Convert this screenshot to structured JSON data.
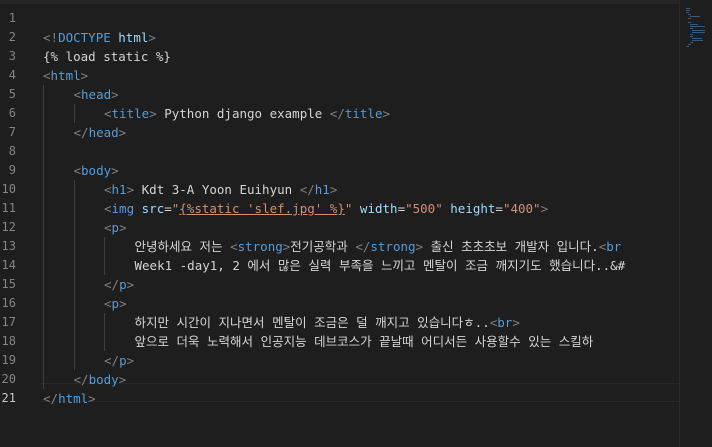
{
  "editor": {
    "active_line": "21",
    "lines": [
      {
        "num": "1",
        "indent": 0,
        "tokens": []
      },
      {
        "num": "2",
        "indent": 0,
        "tokens": [
          {
            "k": "bracket",
            "v": "<!"
          },
          {
            "k": "tag",
            "v": "DOCTYPE"
          },
          {
            "k": "text",
            "v": " "
          },
          {
            "k": "attr",
            "v": "html"
          },
          {
            "k": "bracket",
            "v": ">"
          }
        ]
      },
      {
        "num": "3",
        "indent": 0,
        "tokens": [
          {
            "k": "tpl",
            "v": "{% load static %}"
          }
        ]
      },
      {
        "num": "4",
        "indent": 0,
        "tokens": [
          {
            "k": "bracket",
            "v": "<"
          },
          {
            "k": "tag",
            "v": "html"
          },
          {
            "k": "bracket",
            "v": ">"
          }
        ]
      },
      {
        "num": "5",
        "indent": 1,
        "tokens": [
          {
            "k": "bracket",
            "v": "<"
          },
          {
            "k": "tag",
            "v": "head"
          },
          {
            "k": "bracket",
            "v": ">"
          }
        ]
      },
      {
        "num": "6",
        "indent": 2,
        "tokens": [
          {
            "k": "bracket",
            "v": "<"
          },
          {
            "k": "tag",
            "v": "title"
          },
          {
            "k": "bracket",
            "v": ">"
          },
          {
            "k": "text",
            "v": " Python django example "
          },
          {
            "k": "bracket",
            "v": "</"
          },
          {
            "k": "tag",
            "v": "title"
          },
          {
            "k": "bracket",
            "v": ">"
          }
        ]
      },
      {
        "num": "7",
        "indent": 1,
        "tokens": [
          {
            "k": "bracket",
            "v": "</"
          },
          {
            "k": "tag",
            "v": "head"
          },
          {
            "k": "bracket",
            "v": ">"
          }
        ]
      },
      {
        "num": "8",
        "indent": 1,
        "tokens": []
      },
      {
        "num": "9",
        "indent": 1,
        "tokens": [
          {
            "k": "bracket",
            "v": "<"
          },
          {
            "k": "tag",
            "v": "body"
          },
          {
            "k": "bracket",
            "v": ">"
          }
        ]
      },
      {
        "num": "10",
        "indent": 2,
        "tokens": [
          {
            "k": "bracket",
            "v": "<"
          },
          {
            "k": "tag",
            "v": "h1"
          },
          {
            "k": "bracket",
            "v": ">"
          },
          {
            "k": "text",
            "v": " Kdt 3-A Yoon Euihyun "
          },
          {
            "k": "bracket",
            "v": "</"
          },
          {
            "k": "tag",
            "v": "h1"
          },
          {
            "k": "bracket",
            "v": ">"
          }
        ]
      },
      {
        "num": "11",
        "indent": 2,
        "tokens": [
          {
            "k": "bracket",
            "v": "<"
          },
          {
            "k": "tag",
            "v": "img"
          },
          {
            "k": "text",
            "v": " "
          },
          {
            "k": "attr",
            "v": "src"
          },
          {
            "k": "text",
            "v": "="
          },
          {
            "k": "str",
            "v": "\""
          },
          {
            "k": "str-und",
            "v": "{%static 'slef.jpg' %}"
          },
          {
            "k": "str",
            "v": "\""
          },
          {
            "k": "text",
            "v": " "
          },
          {
            "k": "attr",
            "v": "width"
          },
          {
            "k": "text",
            "v": "="
          },
          {
            "k": "str",
            "v": "\"500\""
          },
          {
            "k": "text",
            "v": " "
          },
          {
            "k": "attr",
            "v": "height"
          },
          {
            "k": "text",
            "v": "="
          },
          {
            "k": "str",
            "v": "\"400\""
          },
          {
            "k": "bracket",
            "v": ">"
          }
        ]
      },
      {
        "num": "12",
        "indent": 2,
        "tokens": [
          {
            "k": "bracket",
            "v": "<"
          },
          {
            "k": "tag",
            "v": "p"
          },
          {
            "k": "bracket",
            "v": ">"
          }
        ]
      },
      {
        "num": "13",
        "indent": 3,
        "tokens": [
          {
            "k": "text",
            "v": "안녕하세요 저는 "
          },
          {
            "k": "bracket",
            "v": "<"
          },
          {
            "k": "tag",
            "v": "strong"
          },
          {
            "k": "bracket",
            "v": ">"
          },
          {
            "k": "text",
            "v": "전기공학과 "
          },
          {
            "k": "bracket",
            "v": "</"
          },
          {
            "k": "tag",
            "v": "strong"
          },
          {
            "k": "bracket",
            "v": ">"
          },
          {
            "k": "text",
            "v": " 출신 초초초보 개발자 입니다."
          },
          {
            "k": "bracket",
            "v": "<"
          },
          {
            "k": "tag",
            "v": "br"
          }
        ]
      },
      {
        "num": "14",
        "indent": 3,
        "tokens": [
          {
            "k": "text",
            "v": "Week1 -day1, 2 에서 많은 실력 부족을 느끼고 멘탈이 조금 깨지기도 했습니다..&#"
          }
        ]
      },
      {
        "num": "15",
        "indent": 2,
        "tokens": [
          {
            "k": "bracket",
            "v": "</"
          },
          {
            "k": "tag",
            "v": "p"
          },
          {
            "k": "bracket",
            "v": ">"
          }
        ]
      },
      {
        "num": "16",
        "indent": 2,
        "tokens": [
          {
            "k": "bracket",
            "v": "<"
          },
          {
            "k": "tag",
            "v": "p"
          },
          {
            "k": "bracket",
            "v": ">"
          }
        ]
      },
      {
        "num": "17",
        "indent": 3,
        "tokens": [
          {
            "k": "text",
            "v": "하지만 시간이 지나면서 멘탈이 조금은 덜 깨지고 있습니다ㅎ.."
          },
          {
            "k": "bracket",
            "v": "<"
          },
          {
            "k": "tag",
            "v": "br"
          },
          {
            "k": "bracket",
            "v": ">"
          }
        ]
      },
      {
        "num": "18",
        "indent": 3,
        "tokens": [
          {
            "k": "text",
            "v": "앞으로 더욱 노력해서 인공지능 데브코스가 끝날때 어디서든 사용할수 있는 스킬하"
          }
        ]
      },
      {
        "num": "19",
        "indent": 2,
        "tokens": [
          {
            "k": "bracket",
            "v": "</"
          },
          {
            "k": "tag",
            "v": "p"
          },
          {
            "k": "bracket",
            "v": ">"
          }
        ]
      },
      {
        "num": "20",
        "indent": 1,
        "tokens": [
          {
            "k": "bracket",
            "v": "</"
          },
          {
            "k": "tag",
            "v": "body"
          },
          {
            "k": "bracket",
            "v": ">"
          }
        ]
      },
      {
        "num": "21",
        "indent": 0,
        "tokens": [
          {
            "k": "bracket",
            "v": "</"
          },
          {
            "k": "tag",
            "v": "html"
          },
          {
            "k": "bracket",
            "v": ">"
          }
        ]
      }
    ]
  },
  "colors": {
    "background": "#1e1e1e",
    "tag": "#569cd6",
    "attribute": "#9cdcfe",
    "string": "#ce9178",
    "bracket": "#808080",
    "text": "#d4d4d4",
    "line_number": "#858585"
  }
}
